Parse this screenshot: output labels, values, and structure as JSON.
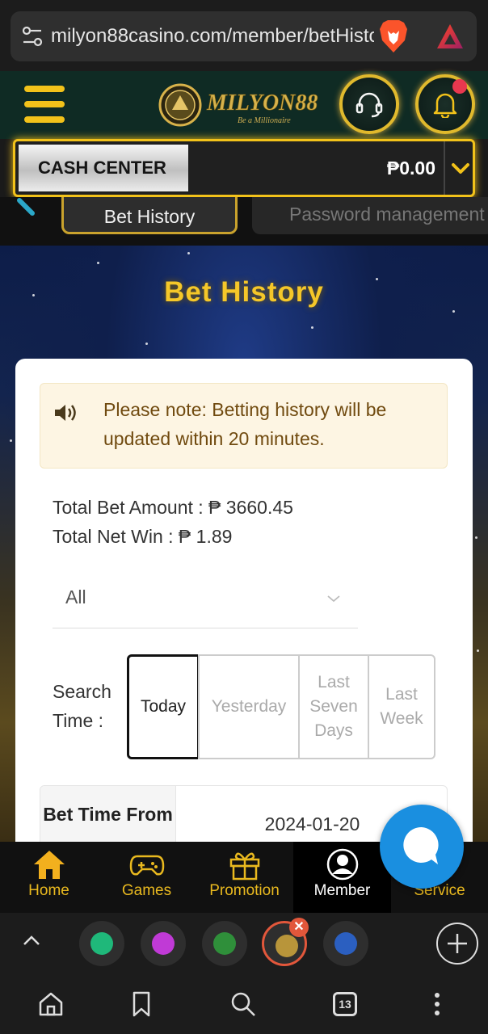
{
  "browser": {
    "url": "milyon88casino.com/member/betHistory",
    "tab_count": "13"
  },
  "header": {
    "logo_text": "MILYON88",
    "logo_tagline": "Be a Millionaire"
  },
  "cash_center": {
    "label": "CASH CENTER",
    "amount": "₱0.00"
  },
  "tabs": {
    "active": "Bet History",
    "inactive": "Password management"
  },
  "page": {
    "title": "Bet History",
    "notice": "Please note: Betting history will be updated within 20 minutes.",
    "total_bet": "Total Bet Amount : ₱ 3660.45",
    "total_net_win": "Total Net Win : ₱ 1.89",
    "filter_value": "All",
    "search_time_label": "Search Time :",
    "search_options": [
      "Today",
      "Yesterday",
      "Last Seven Days",
      "Last Week"
    ],
    "table": {
      "header": "Bet Time From",
      "value": "2024-01-20"
    }
  },
  "nav": {
    "items": [
      "Home",
      "Games",
      "Promotion",
      "Member",
      "Service"
    ]
  },
  "colors": {
    "gold": "#f2c21a",
    "header_bg": "#0f2b24",
    "chat_blue": "#1a8fe0"
  }
}
